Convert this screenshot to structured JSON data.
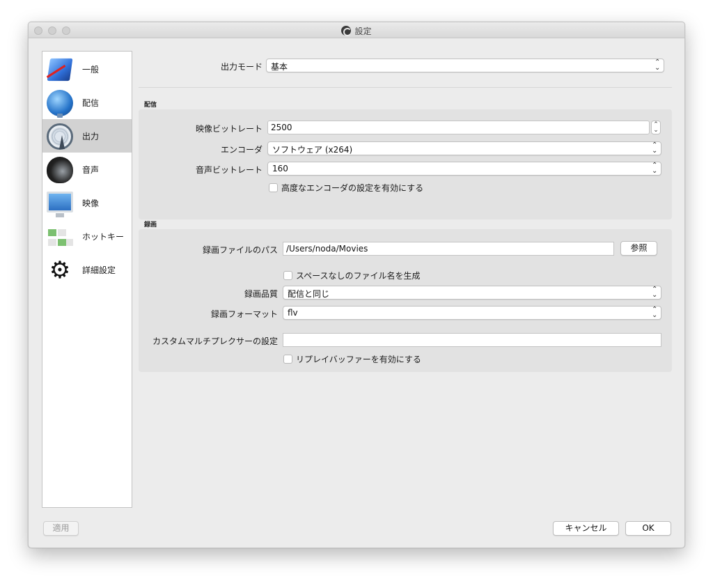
{
  "window": {
    "title": "設定"
  },
  "sidebar": {
    "items": [
      {
        "label": "一般",
        "icon": "general-settings-icon"
      },
      {
        "label": "配信",
        "icon": "stream-globe-icon"
      },
      {
        "label": "出力",
        "icon": "output-broadcast-icon",
        "selected": true
      },
      {
        "label": "音声",
        "icon": "speaker-icon"
      },
      {
        "label": "映像",
        "icon": "monitor-icon"
      },
      {
        "label": "ホットキー",
        "icon": "hotkey-keyboard-icon"
      },
      {
        "label": "詳細設定",
        "icon": "gears-icon"
      }
    ]
  },
  "output_mode": {
    "label": "出力モード",
    "value": "基本"
  },
  "streaming": {
    "title": "配信",
    "video_bitrate": {
      "label": "映像ビットレート",
      "value": "2500"
    },
    "encoder": {
      "label": "エンコーダ",
      "value": "ソフトウェア (x264)"
    },
    "audio_bitrate": {
      "label": "音声ビットレート",
      "value": "160"
    },
    "advanced_encoder": {
      "label": "高度なエンコーダの設定を有効にする",
      "checked": false
    }
  },
  "recording": {
    "title": "録画",
    "path": {
      "label": "録画ファイルのパス",
      "value": "/Users/noda/Movies",
      "browse_label": "参照"
    },
    "no_space_filename": {
      "label": "スペースなしのファイル名を生成",
      "checked": false
    },
    "quality": {
      "label": "録画品質",
      "value": "配信と同じ"
    },
    "format": {
      "label": "録画フォーマット",
      "value": "flv"
    },
    "muxer_settings": {
      "label": "カスタムマルチプレクサーの設定",
      "value": ""
    },
    "replay_buffer": {
      "label": "リプレイバッファーを有効にする",
      "checked": false
    }
  },
  "footer": {
    "apply_label": "適用",
    "cancel_label": "キャンセル",
    "ok_label": "OK"
  },
  "colors": {
    "window_bg": "#ececec",
    "selected_item": "#d2d2d2",
    "group_bg": "#e2e2e2"
  }
}
